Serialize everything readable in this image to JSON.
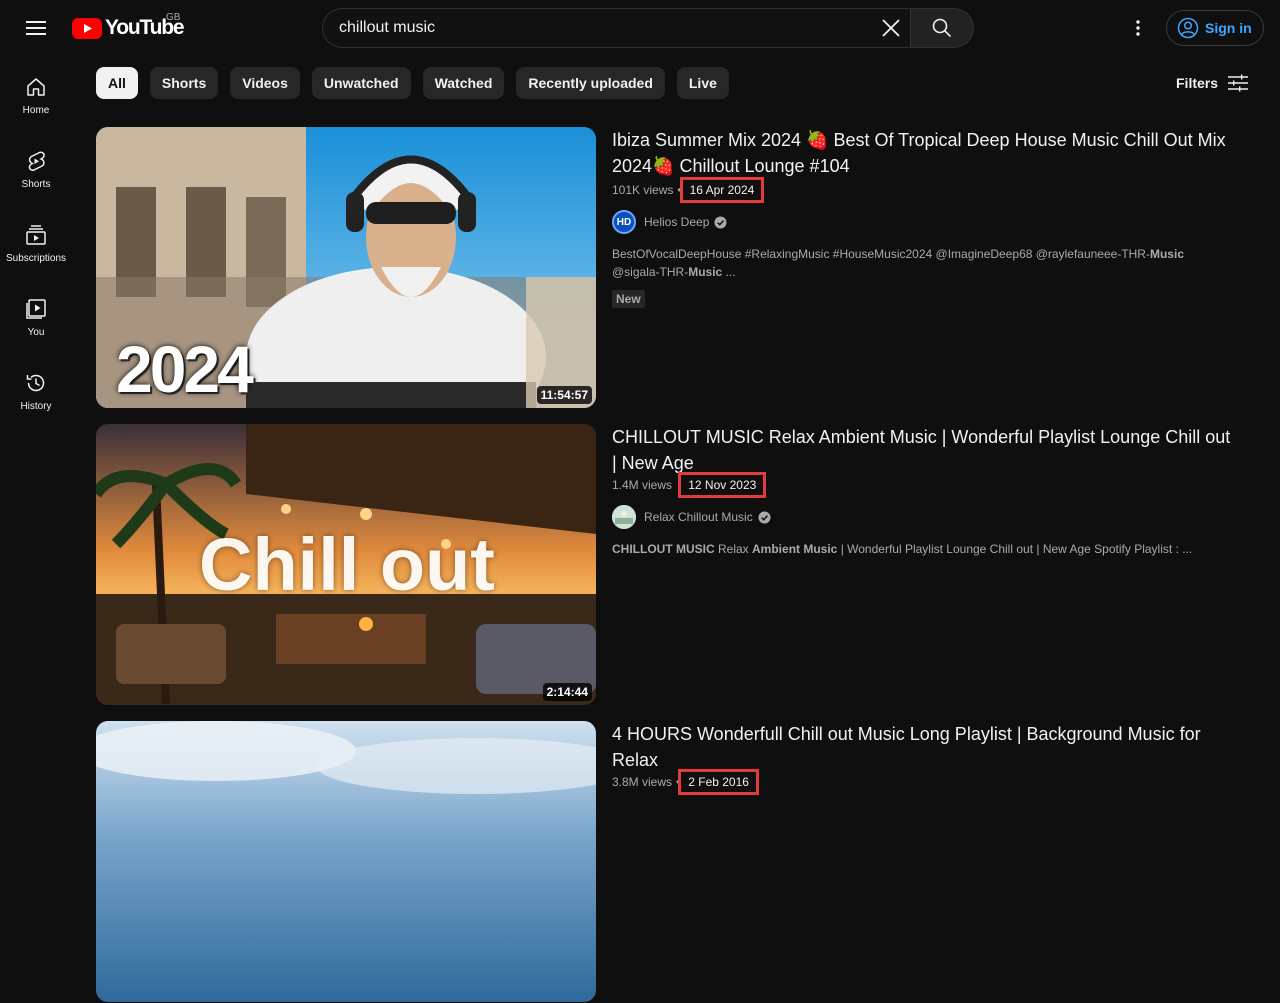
{
  "header": {
    "logo_text": "YouTube",
    "country": "GB",
    "search_value": "chillout music",
    "signin_label": "Sign in"
  },
  "sidebar": {
    "items": [
      {
        "label": "Home",
        "icon": "home-icon"
      },
      {
        "label": "Shorts",
        "icon": "shorts-icon"
      },
      {
        "label": "Subscriptions",
        "icon": "subscriptions-icon"
      },
      {
        "label": "You",
        "icon": "you-icon"
      },
      {
        "label": "History",
        "icon": "history-icon"
      }
    ]
  },
  "chips": [
    "All",
    "Shorts",
    "Videos",
    "Unwatched",
    "Watched",
    "Recently uploaded",
    "Live"
  ],
  "filters_label": "Filters",
  "results": [
    {
      "title": "Ibiza Summer Mix 2024 🍓 Best Of Tropical Deep House Music Chill Out Mix 2024🍓 Chillout Lounge #104",
      "views": "101K views",
      "date": "16 Apr 2024",
      "channel": "Helios Deep",
      "channel_initials": "HD",
      "description_parts": [
        "BestOfVocalDeepHouse #RelaxingMusic #HouseMusic2024 @ImagineDeep68 @raylefauneee-THR-",
        "Music",
        " @sigala-THR-",
        "Music",
        " ..."
      ],
      "badge": "New",
      "duration": "11:54:57",
      "thumb_text": "2024"
    },
    {
      "title": "CHILLOUT MUSIC Relax Ambient Music | Wonderful Playlist Lounge Chill out | New Age",
      "views": "1.4M views",
      "date": "12 Nov 2023",
      "channel": "Relax Chillout Music",
      "description_parts": [
        "CHILLOUT MUSIC",
        " Relax ",
        "Ambient Music",
        " | Wonderful Playlist Lounge Chill out | New Age Spotify Playlist : ..."
      ],
      "duration": "2:14:44",
      "thumb_text": "Chill out"
    },
    {
      "title": "4 HOURS Wonderfull Chill out Music Long Playlist | Background Music for Relax",
      "views": "3.8M views",
      "date": "2 Feb 2016"
    }
  ],
  "colors": {
    "background": "#0f0f0f",
    "accent_red": "#ff0000",
    "signin_blue": "#3ea6ff",
    "highlight_box": "#e23b3b"
  }
}
